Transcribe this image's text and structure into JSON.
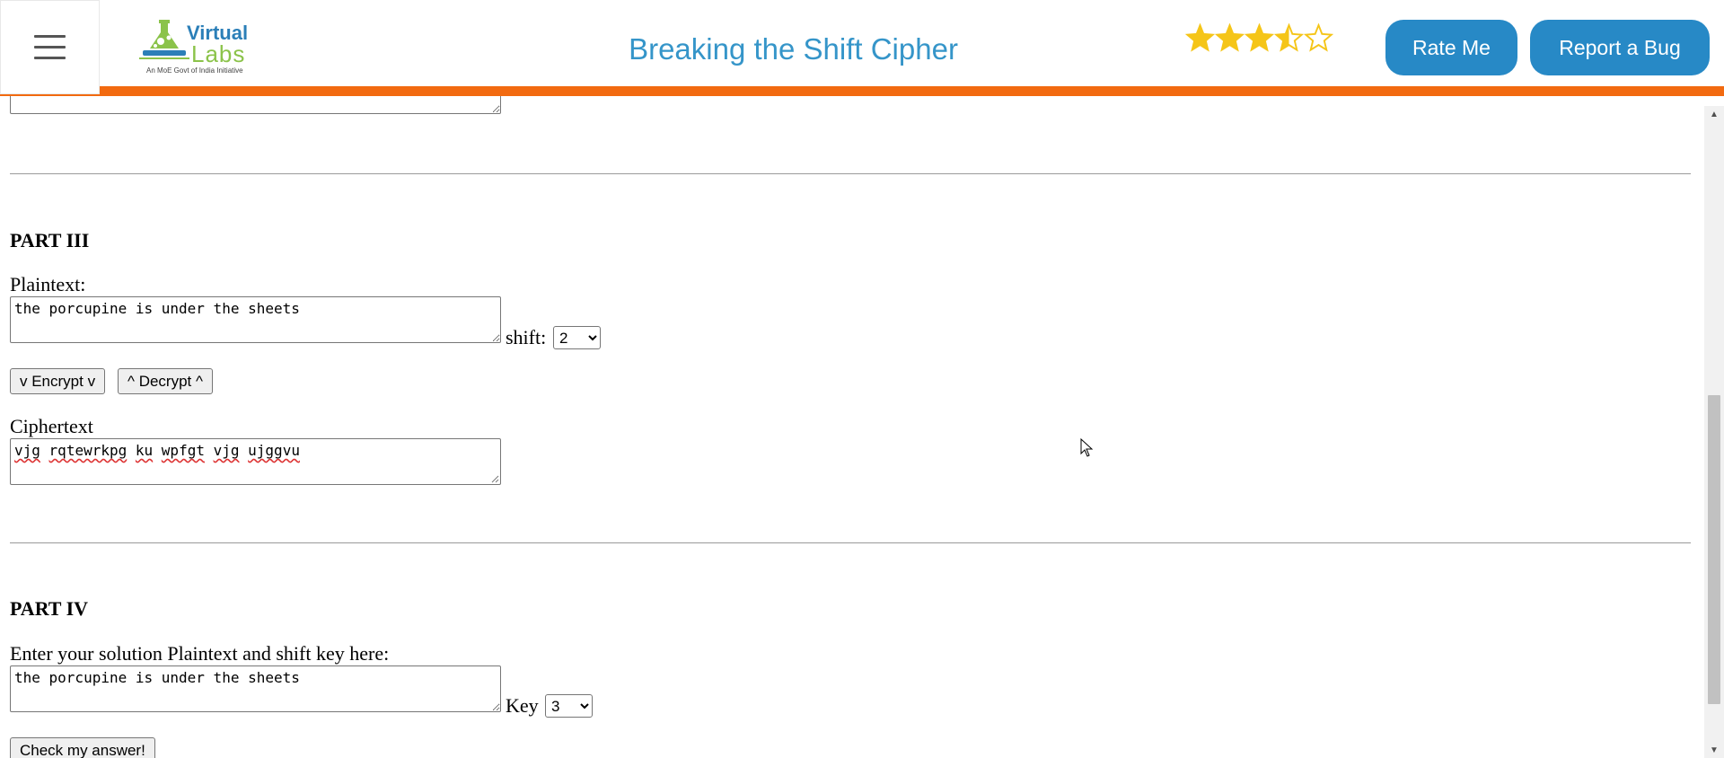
{
  "header": {
    "logo": {
      "word1": "Virtual",
      "word2": "Labs",
      "tagline": "An MoE Govt of India Initiative"
    },
    "title": "Breaking the Shift Cipher",
    "rating": {
      "value": 3.5,
      "max": 5
    },
    "rate_label": "Rate Me",
    "bug_label": "Report a Bug",
    "colors": {
      "accent_bar": "#f26a10",
      "button_blue": "#2789c6",
      "star_gold": "#f5c518"
    }
  },
  "part3": {
    "title": "PART III",
    "plaintext_label": "Plaintext:",
    "plaintext_value": "the porcupine is under the sheets",
    "shift_label": "shift:",
    "shift_value": "2",
    "encrypt_label": "v Encrypt v",
    "decrypt_label": "^ Decrypt ^",
    "ciphertext_label": "Ciphertext",
    "ciphertext_words": [
      "vjg",
      "rqtewrkpg",
      "ku",
      "wpfgt",
      "vjg",
      "ujggvu"
    ]
  },
  "part4": {
    "title": "PART IV",
    "prompt": "Enter your solution Plaintext and shift key here:",
    "solution_value": "the porcupine is under the sheets",
    "key_label": "Key",
    "key_value": "3",
    "check_label": "Check my answer!"
  }
}
